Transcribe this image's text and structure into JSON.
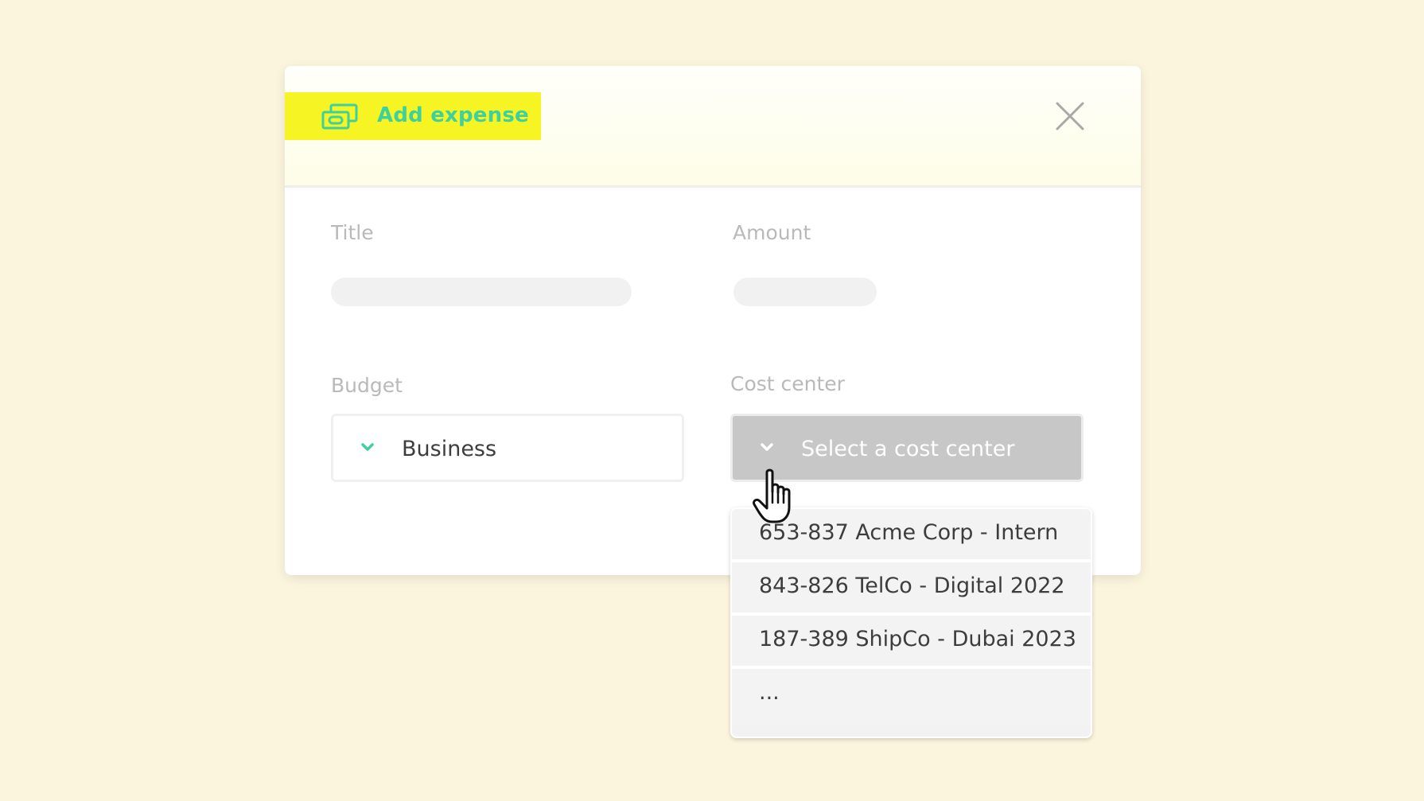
{
  "modal": {
    "title": "Add expense",
    "title_icon": "money-icon",
    "close_icon": "close-icon"
  },
  "form": {
    "title_label": "Title",
    "amount_label": "Amount",
    "budget_label": "Budget",
    "budget_value": "Business",
    "cost_center_label": "Cost center",
    "cost_center_placeholder": "Select a cost center"
  },
  "dropdown": {
    "options": [
      "653-837 Acme Corp - Intern",
      "843-826 TelCo - Digital 2022",
      "187-389 ShipCo - Dubai 2023",
      "..."
    ]
  },
  "colors": {
    "background": "#fcf5de",
    "title_highlight": "#f6f423",
    "accent": "#3fd0a0",
    "active_select": "#c7c7c7"
  }
}
